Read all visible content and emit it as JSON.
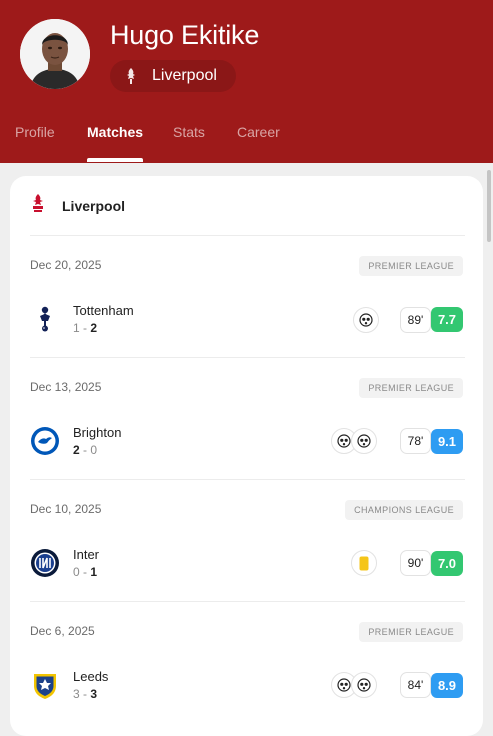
{
  "player": {
    "name": "Hugo Ekitike",
    "club": "Liverpool"
  },
  "tabs": [
    {
      "label": "Profile",
      "active": false
    },
    {
      "label": "Matches",
      "active": true
    },
    {
      "label": "Stats",
      "active": false
    },
    {
      "label": "Career",
      "active": false
    }
  ],
  "team_section": {
    "label": "Liverpool"
  },
  "colors": {
    "header": "#9e1a1a",
    "rating_green": "#33c771",
    "rating_blue": "#2e9cf2"
  },
  "matches": [
    {
      "date": "Dec 20, 2025",
      "competition": "PREMIER LEAGUE",
      "opponent": "Tottenham",
      "score_left": "1",
      "score_right": "2",
      "bold_side": "right",
      "events": [
        "football-icon"
      ],
      "minutes": "89'",
      "rating": "7.7",
      "rating_color": "#33c771"
    },
    {
      "date": "Dec 13, 2025",
      "competition": "PREMIER LEAGUE",
      "opponent": "Brighton",
      "score_left": "2",
      "score_right": "0",
      "bold_side": "left",
      "events": [
        "football-icon",
        "football-icon"
      ],
      "minutes": "78'",
      "rating": "9.1",
      "rating_color": "#2e9cf2"
    },
    {
      "date": "Dec 10, 2025",
      "competition": "CHAMPIONS LEAGUE",
      "opponent": "Inter",
      "score_left": "0",
      "score_right": "1",
      "bold_side": "right",
      "events": [
        "yellow-card-icon"
      ],
      "minutes": "90'",
      "rating": "7.0",
      "rating_color": "#33c771"
    },
    {
      "date": "Dec 6, 2025",
      "competition": "PREMIER LEAGUE",
      "opponent": "Leeds",
      "score_left": "3",
      "score_right": "3",
      "bold_side": "right",
      "events": [
        "football-icon",
        "football-icon"
      ],
      "minutes": "84'",
      "rating": "8.9",
      "rating_color": "#2e9cf2"
    }
  ]
}
